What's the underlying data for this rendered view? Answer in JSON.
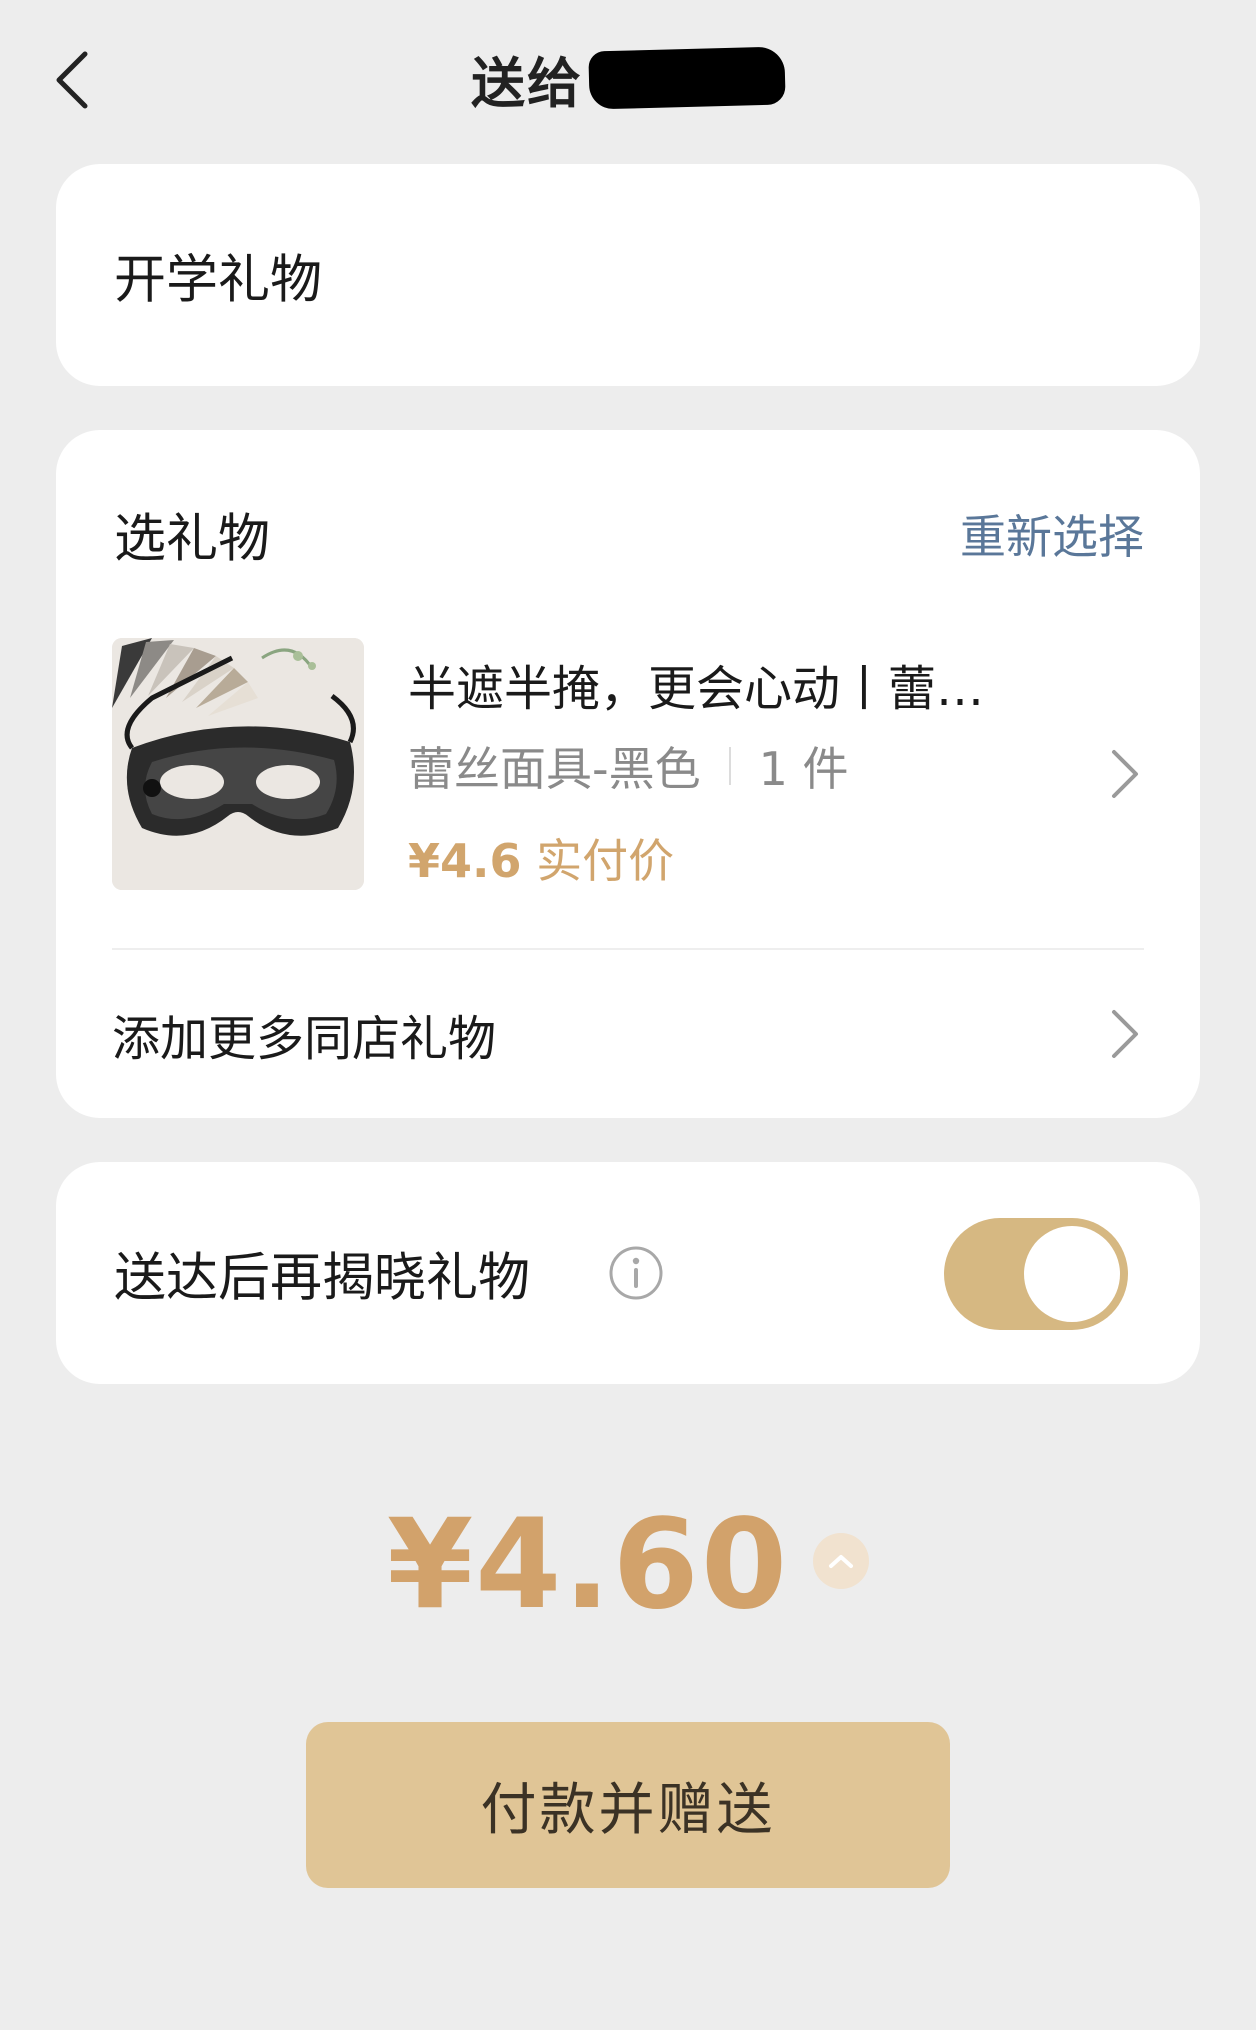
{
  "header": {
    "title": "送给"
  },
  "message": {
    "text": "开学礼物"
  },
  "gift_section": {
    "title": "选礼物",
    "reselect_label": "重新选择",
    "product": {
      "name": "半遮半掩，更会心动丨蕾…",
      "spec": "蕾丝面具-黑色",
      "quantity": "1 件",
      "price": "¥4.6",
      "price_label": "实付价"
    },
    "add_more_label": "添加更多同店礼物"
  },
  "reveal": {
    "label": "送达后再揭晓礼物",
    "enabled": true
  },
  "total": {
    "amount": "¥4.60"
  },
  "pay_button": {
    "label": "付款并赠送"
  },
  "colors": {
    "accent": "#d2a26b",
    "button": "#e0c596",
    "toggle_on": "#d6b882",
    "link": "#5a7799",
    "background": "#ededed"
  }
}
